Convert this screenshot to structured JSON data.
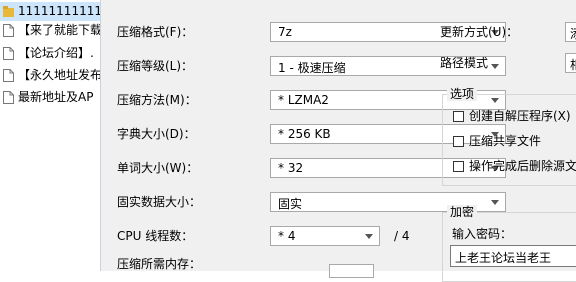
{
  "file_list": [
    {
      "name": "11111111111",
      "icon": "folder-icon",
      "selected": true
    },
    {
      "name": "【来了就能下载",
      "icon": "file-icon"
    },
    {
      "name": "【论坛介绍】.",
      "icon": "file-icon"
    },
    {
      "name": "【永久地址发布",
      "icon": "file-icon"
    },
    {
      "name": "最新地址及AP",
      "icon": "file-icon"
    }
  ],
  "settings": {
    "format_label": "压缩格式(F)：",
    "format_value": "7z",
    "level_label": "压缩等级(L)：",
    "level_value": "1 - 极速压缩",
    "method_label": "压缩方法(M)：",
    "method_value": "* LZMA2",
    "dict_label": "字典大小(D)：",
    "dict_value": "* 256 KB",
    "word_label": "单词大小(W)：",
    "word_value": "* 32",
    "solid_label": "固实数据大小：",
    "solid_value": "固实",
    "threads_label": "CPU 线程数：",
    "threads_value": "* 4",
    "threads_total": "/ 4",
    "memory_label": "压缩所需内存："
  },
  "right": {
    "update_label": "更新方式(U)：",
    "update_value": "添",
    "path_label": "路径模式",
    "path_value": "相"
  },
  "options": {
    "title": "选项",
    "items": [
      {
        "label": "创建自解压程序(X)",
        "checked": false
      },
      {
        "label": "压缩共享文件",
        "checked": false
      },
      {
        "label": "操作完成后删除源文",
        "checked": false
      }
    ]
  },
  "encryption": {
    "title": "加密",
    "password_label": "输入密码：",
    "password_value": "上老王论坛当老王"
  }
}
